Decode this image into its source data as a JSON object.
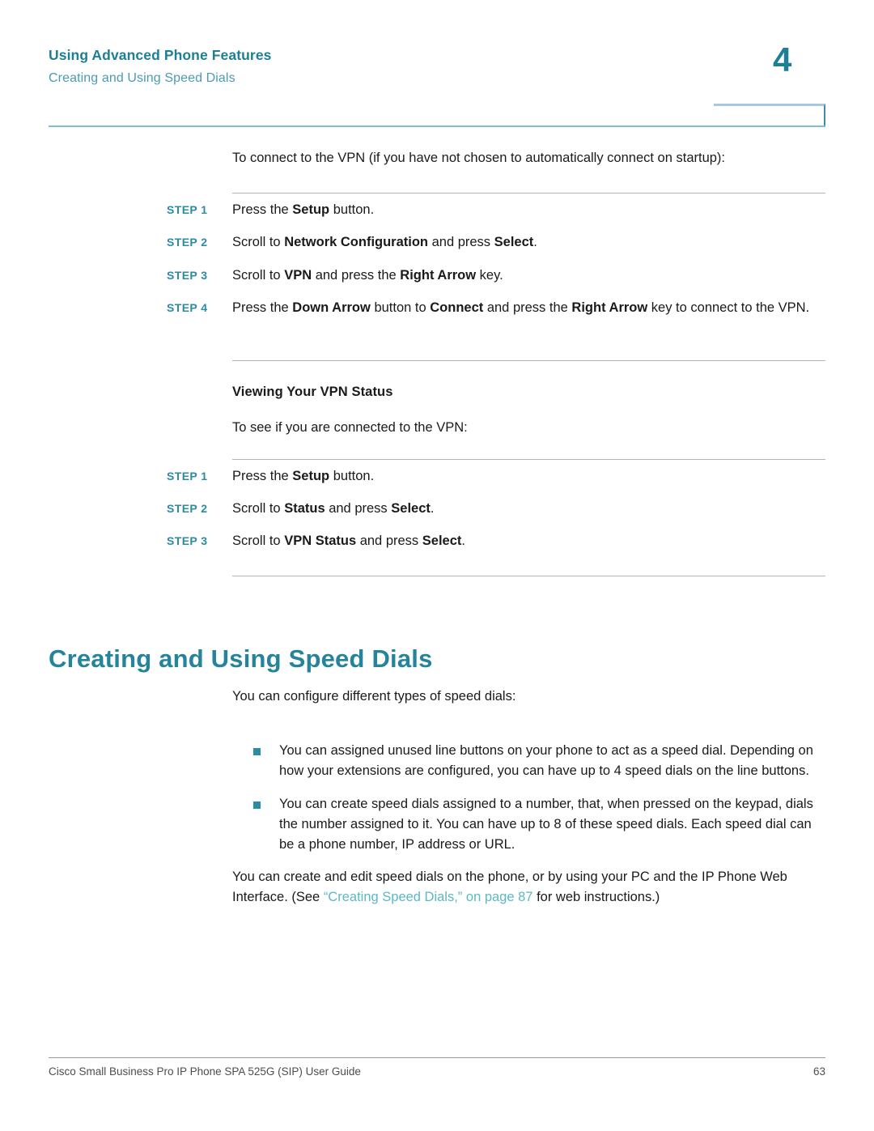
{
  "header": {
    "title": "Using Advanced Phone Features",
    "subtitle": "Creating and Using Speed Dials",
    "chapter_number": "4",
    "accent_color": "#1d7e94",
    "subtitle_color": "#4b9cb0",
    "rule_color": "#7cc0ce"
  },
  "intro": {
    "text": "To connect to the VPN (if you have not chosen to automatically connect on startup):"
  },
  "steps_connect": [
    {
      "label": "STEP 1",
      "parts": [
        {
          "text": "Press the ",
          "bold": false
        },
        {
          "text": "Setup",
          "bold": true
        },
        {
          "text": " button.",
          "bold": false
        }
      ]
    },
    {
      "label": "STEP 2",
      "parts": [
        {
          "text": "Scroll to ",
          "bold": false
        },
        {
          "text": "Network Configuration",
          "bold": true
        },
        {
          "text": " and press ",
          "bold": false
        },
        {
          "text": "Select",
          "bold": true
        },
        {
          "text": ".",
          "bold": false
        }
      ]
    },
    {
      "label": "STEP 3",
      "parts": [
        {
          "text": "Scroll to ",
          "bold": false
        },
        {
          "text": "VPN",
          "bold": true
        },
        {
          "text": " and press the ",
          "bold": false
        },
        {
          "text": "Right Arrow",
          "bold": true
        },
        {
          "text": " key.",
          "bold": false
        }
      ]
    },
    {
      "label": "STEP 4",
      "parts": [
        {
          "text": "Press the ",
          "bold": false
        },
        {
          "text": "Down Arrow",
          "bold": true
        },
        {
          "text": " button to ",
          "bold": false
        },
        {
          "text": "Connect",
          "bold": true
        },
        {
          "text": " and press the ",
          "bold": false
        },
        {
          "text": "Right Arrow",
          "bold": true
        },
        {
          "text": " key to connect to the VPN.",
          "bold": false
        }
      ]
    }
  ],
  "vpn_status": {
    "heading": "Viewing Your VPN Status",
    "intro": "To see if you are connected to the VPN:"
  },
  "steps_status": [
    {
      "label": "STEP 1",
      "parts": [
        {
          "text": "Press the ",
          "bold": false
        },
        {
          "text": "Setup",
          "bold": true
        },
        {
          "text": " button.",
          "bold": false
        }
      ]
    },
    {
      "label": "STEP 2",
      "parts": [
        {
          "text": "Scroll to ",
          "bold": false
        },
        {
          "text": "Status",
          "bold": true
        },
        {
          "text": " and press ",
          "bold": false
        },
        {
          "text": "Select",
          "bold": true
        },
        {
          "text": ".",
          "bold": false
        }
      ]
    },
    {
      "label": "STEP 3",
      "parts": [
        {
          "text": "Scroll to ",
          "bold": false
        },
        {
          "text": "VPN Status",
          "bold": true
        },
        {
          "text": " and press ",
          "bold": false
        },
        {
          "text": "Select",
          "bold": true
        },
        {
          "text": ".",
          "bold": false
        }
      ]
    }
  ],
  "section": {
    "heading": "Creating and Using Speed Dials",
    "heading_color": "#25849b",
    "intro": "You can configure different types of speed dials:",
    "bullets": [
      "You can assigned unused line buttons on your phone to act as a speed dial. Depending on how your extensions are configured, you can have up to 4 speed dials on the line buttons.",
      "You can create speed dials assigned to a number, that, when pressed on the keypad, dials the number assigned to it. You can have up to 8 of these speed dials. Each speed dial can be a phone number, IP address or URL."
    ],
    "bullet_color": "#2b8ca5",
    "closing": {
      "before": "You can create and edit speed dials on the phone, or by using your PC and the IP Phone Web Interface. (See ",
      "link": "“Creating Speed Dials,” on page 87",
      "after": " for web instructions.)",
      "link_color": "#5bb8c4"
    }
  },
  "footer": {
    "text": "Cisco Small Business Pro IP Phone SPA 525G (SIP) User Guide",
    "page_number": "63"
  }
}
